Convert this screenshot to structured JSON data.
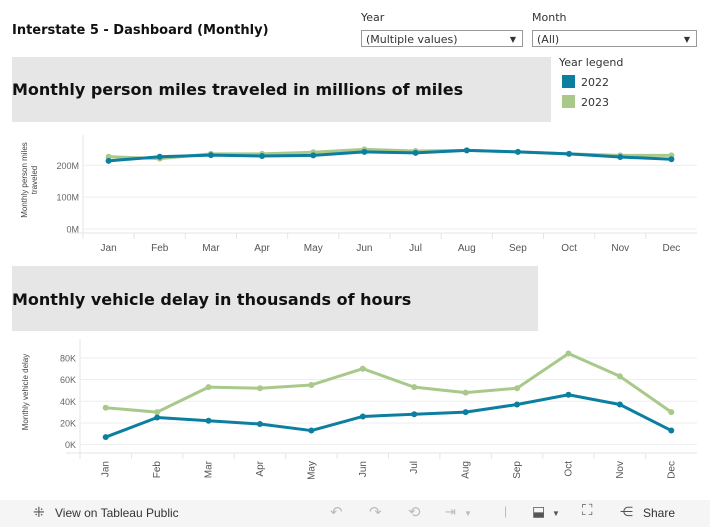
{
  "header": {
    "title": "Interstate 5 - Dashboard (Monthly)"
  },
  "filters": {
    "year": {
      "label": "Year",
      "value": "(Multiple values)"
    },
    "month": {
      "label": "Month",
      "value": "(All)"
    }
  },
  "legend": {
    "title": "Year legend",
    "items": [
      {
        "label": "2022",
        "color": "#0c7fa0"
      },
      {
        "label": "2023",
        "color": "#a8c98a"
      }
    ]
  },
  "sections": {
    "pmt_title": "Monthly person miles traveled in millions of miles",
    "delay_title": "Monthly vehicle delay in thousands of hours"
  },
  "chart_data": [
    {
      "type": "line",
      "title": "Monthly person miles traveled in millions of miles",
      "ylabel": "Monthly person miles traveled",
      "xlabel": "",
      "categories": [
        "Jan",
        "Feb",
        "Mar",
        "Apr",
        "May",
        "Jun",
        "Jul",
        "Aug",
        "Sep",
        "Oct",
        "Nov",
        "Dec"
      ],
      "yticks": [
        "0M",
        "100M",
        "200M"
      ],
      "ytick_values": [
        0,
        100,
        200
      ],
      "ylim": [
        0,
        270
      ],
      "grid": true,
      "series": [
        {
          "name": "2022",
          "color": "#0c7fa0",
          "values": [
            214,
            227,
            232,
            229,
            231,
            242,
            239,
            247,
            242,
            236,
            226,
            219
          ]
        },
        {
          "name": "2023",
          "color": "#a8c98a",
          "values": [
            227,
            221,
            236,
            236,
            241,
            250,
            245,
            247,
            242,
            236,
            231,
            231
          ]
        }
      ]
    },
    {
      "type": "line",
      "title": "Monthly vehicle delay in thousands of hours",
      "ylabel": "Monthly vehicle delay",
      "xlabel": "",
      "categories": [
        "Jan",
        "Feb",
        "Mar",
        "Apr",
        "May",
        "Jun",
        "Jul",
        "Aug",
        "Sep",
        "Oct",
        "Nov",
        "Dec"
      ],
      "yticks": [
        "0K",
        "20K",
        "40K",
        "60K",
        "80K"
      ],
      "ytick_values": [
        0,
        20,
        40,
        60,
        80
      ],
      "ylim": [
        -4,
        90
      ],
      "grid": true,
      "series": [
        {
          "name": "2022",
          "color": "#0c7fa0",
          "values": [
            7,
            25,
            22,
            19,
            13,
            26,
            28,
            30,
            37,
            46,
            37,
            13
          ]
        },
        {
          "name": "2023",
          "color": "#a8c98a",
          "values": [
            34,
            30,
            53,
            52,
            55,
            70,
            53,
            48,
            52,
            84,
            63,
            30
          ]
        }
      ]
    }
  ],
  "footer": {
    "view_label": "View on Tableau Public",
    "share_label": "Share"
  }
}
